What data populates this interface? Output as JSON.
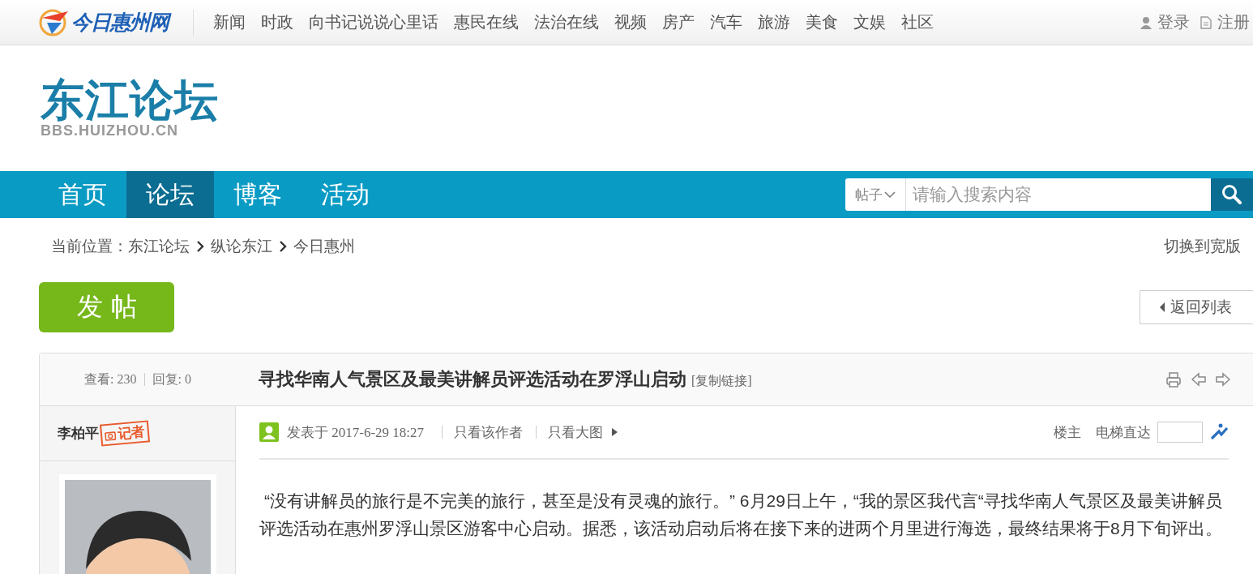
{
  "top_bar": {
    "logo": "今日惠州网",
    "nav": [
      {
        "label": "新闻"
      },
      {
        "label": "时政"
      },
      {
        "label": "向书记说说心里话"
      },
      {
        "label": "惠民在线"
      },
      {
        "label": "法治在线"
      },
      {
        "label": "视频"
      },
      {
        "label": "房产"
      },
      {
        "label": "汽车"
      },
      {
        "label": "旅游"
      },
      {
        "label": "美食"
      },
      {
        "label": "文娱"
      },
      {
        "label": "社区"
      }
    ],
    "auth": [
      {
        "kind": "login",
        "label": "登录"
      },
      {
        "kind": "register",
        "label": "注册"
      }
    ]
  },
  "header": {
    "logo_title": "东江论坛",
    "logo_subtitle": "BBS.HUIZHOU.CN"
  },
  "main_nav": {
    "items": [
      {
        "label": "首页",
        "selected": false
      },
      {
        "label": "论坛",
        "selected": true
      },
      {
        "label": "博客",
        "selected": false
      },
      {
        "label": "活动",
        "selected": false
      }
    ],
    "search": {
      "scope": "帖子",
      "placeholder": "请输入搜索内容"
    }
  },
  "breadcrumb": {
    "prefix": "当前位置：",
    "items": [
      "东江论坛",
      "纵论东江",
      "今日惠州"
    ]
  },
  "switch_link": "切换到宽版",
  "actions": {
    "post_button": "发帖",
    "back_button": "返回列表"
  },
  "thread": {
    "stats": [
      "查看: 230",
      "回复: 0"
    ],
    "title": "寻找华南人气景区及最美讲解员评选活动在罗浮山启动",
    "copy_link": "[复制链接]"
  },
  "post": {
    "author": "李柏平",
    "badge": "记者",
    "posted": "发表于 2017-6-29 18:27",
    "links": [
      "只看该作者",
      "只看大图"
    ],
    "floor": "楼主",
    "jump_label": "电梯直达",
    "body": "“没有讲解员的旅行是不完美的旅行，甚至是没有灵魂的旅行。” 6月29日上午，“我的景区我代言“寻找华南人气景区及最美讲解员评选活动在惠州罗浮山景区游客中心启动。据悉，该活动启动后将在接下来的进两个月里进行海选，最终结果将于8月下旬评出。"
  }
}
